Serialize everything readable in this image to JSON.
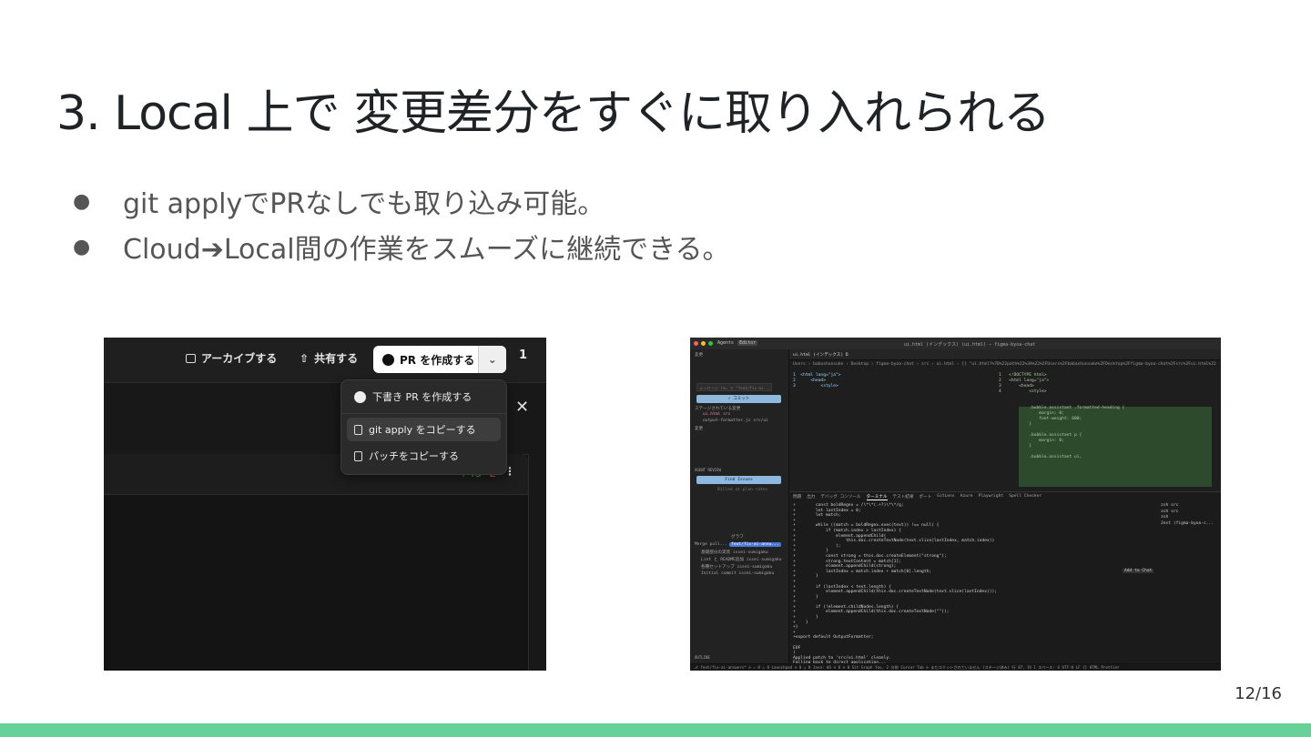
{
  "slide": {
    "title": "3. Local 上で 変更差分をすぐに取り入れられる",
    "bullets": [
      "git applyでPRなしでも取り込み可能。",
      "Cloud➔Local間の作業をスムーズに継続できる。"
    ],
    "page_number": "12/16",
    "accent_color": "#67d19a"
  },
  "left_screenshot": {
    "toolbar": {
      "archive_label": "アーカイブする",
      "share_label": "共有する",
      "create_pr_label": "PR を作成する",
      "user_badge": "1"
    },
    "dropdown": {
      "draft_pr_label": "下書き PR を作成する",
      "copy_git_apply_label": "git apply をコピーする",
      "copy_patch_label": "パッチをコピーする"
    },
    "diff_stat": {
      "added": "+43",
      "removed": "-2"
    },
    "close_glyph": "✕",
    "kebab_glyph": "⋮"
  },
  "right_screenshot": {
    "window_tabs": [
      "Agents",
      "Editor"
    ],
    "window_title": "ui.html (インデックス) (ui.html) — figma-byoa-chat",
    "file_tab": "ui.html (インデックス) D",
    "breadcrumb": "Users › babashunsuke › Desktop › figma-byoa-chat › src › ui.html › {} \"ui.html?%7B%22path%22%3A%22%2FUsers%2Fbabashunsuke%2FDesktop%2Ffigma-byoa-chat%2Fsrc%2Fui.html%22",
    "sidebar": {
      "section_changes": "変更",
      "message_placeholder": "メッセージ (⌘↵ で \"feat/fix-ai...",
      "commit_label": "✓ コミット",
      "staged_label": "ステージされている変更",
      "staged_files": [
        "ui.html src",
        "output-formatter.js src/ui"
      ],
      "changes_label": "変更",
      "agent_review": "AGENT REVIEW",
      "find_issues_label": "Find Issues",
      "billed_text": "Billed at plan rates",
      "graph_label": "グラフ",
      "commits": [
        "Merge pull...",
        "基礎部分の実装 issei-sumigaku",
        "Lint と README追加 issei-sumigaku",
        "各種セットアップ issei-sumigaku",
        "Initial commit issei-sumigaku"
      ],
      "outline_label": "OUTLINE",
      "branch_badge": "feat/fix-ai-answ..."
    },
    "left_code": "1  <html lang=\"ja\">\n2      <head>\n3          <style>",
    "right_code": "1   <!DOCTYPE html>\n2   <html lang=\"ja\">\n3       <head>\n4           <style>\n\n\n            .bubble.assistant .formatted-heading {\n                margin: 0;\n                font-weight: 600;\n            }\n\n            .bubble.assistant p {\n                margin: 0;\n            }\n\n            .bubble.assistant ul,",
    "terminal_tabs": [
      "問題",
      "出力",
      "デバッグ コンソール",
      "ターミナル",
      "テスト結果",
      "ポート",
      "GitLens",
      "Azure",
      "Playwright",
      "Spell Checker"
    ],
    "terminal_code": "+        const boldRegex = /\\*\\*(.+?)\\*\\*/g;\n+        let lastIndex = 0;\n+        let match;\n+\n+        while ((match = boldRegex.exec(text)) !== null) {\n+            if (match.index > lastIndex) {\n+                element.appendChild(\n+                    this.doc.createTextNode(text.slice(lastIndex, match.index))\n+                );\n+            }\n+            const strong = this.doc.createElement(\"strong\");\n+            strong.textContent = match[1];\n+            element.appendChild(strong);\n+            lastIndex = match.index + match[0].length;\n+        }\n+\n+        if (lastIndex < text.length) {\n+            element.appendChild(this.doc.createTextNode(text.slice(lastIndex)));\n+        }\n+\n+        if (!element.childNodes.length) {\n+            element.appendChild(this.doc.createTextNode(\"\"));\n+        }\n+    }\n+}\n+\n+export default OutputFormatter;\n\nEOF\n)\nApplied patch to 'src/ui.html' cleanly.\nFalling back to direct application...\nbabashunsuke@babashunsukenoMacBook-Pro-2 figma-byoa-chat % █",
    "add_to_chat": "Add to Chat",
    "shells": "zsh src\nzsh src\nzsh\nJest (figma-byoa-c...",
    "status_bar": "⎇ feat/fix-ai-answers*  ⊙  ⚠ 0 △ 0   Launchpad   ⊙ 0 △ 0   Java: W3 ⊙ 0 ⊙ 0   Git Graph        You, 2 分前   Cursor Tab   ⊙ まだコミットされていません (ステージ済み)   行 87, 列 1   スペース: 4   UTF-8   LF   {} HTML   Prettier"
  }
}
